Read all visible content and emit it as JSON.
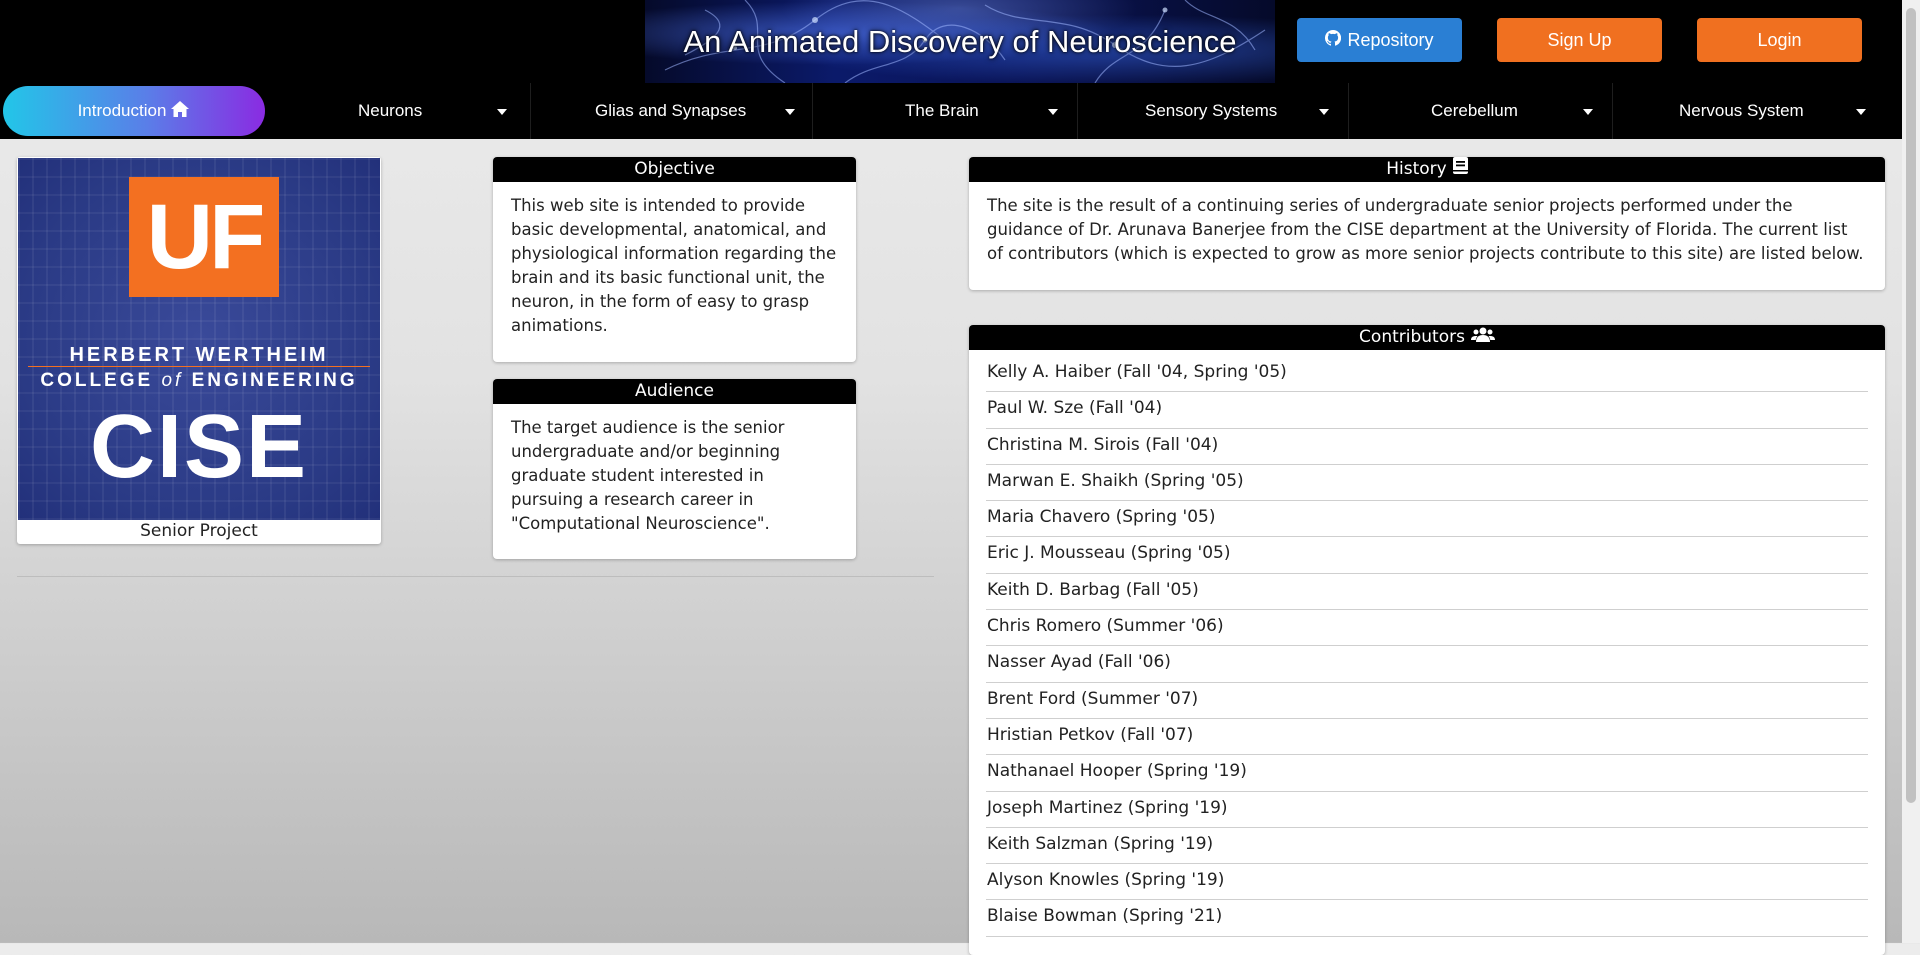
{
  "header": {
    "banner_title": "An Animated Discovery of Neuroscience",
    "repo_label": "Repository",
    "signup_label": "Sign Up",
    "login_label": "Login"
  },
  "nav": {
    "intro": "Introduction",
    "items": [
      "Neurons",
      "Glias and Synapses",
      "The Brain",
      "Sensory Systems",
      "Cerebellum",
      "Nervous System"
    ]
  },
  "logo": {
    "uf": "UF",
    "line1": "HERBERT WERTHEIM",
    "line2_a": "COLLEGE ",
    "line2_of": "of",
    "line2_b": " ENGINEERING",
    "cise": "CISE",
    "caption": "Senior Project"
  },
  "objective": {
    "title": "Objective",
    "text": "This web site is intended to provide basic developmental, anatomical, and physiological information regarding the brain and its basic functional unit, the neuron, in the form of easy to grasp animations."
  },
  "audience": {
    "title": "Audience",
    "text": "The target audience is the senior undergraduate and/or beginning graduate student interested in pursuing a research career in \"Computational Neuroscience\"."
  },
  "history": {
    "title": "History",
    "text": "The site is the result of a continuing series of undergraduate senior projects performed under the guidance of Dr. Arunava Banerjee from the CISE department at the University of Florida. The current list of contributors (which is expected to grow as more senior projects contribute to this site) are listed below."
  },
  "contributors": {
    "title": "Contributors",
    "list": [
      "Kelly A. Haiber (Fall '04, Spring '05)",
      "Paul W. Sze (Fall '04)",
      "Christina M. Sirois (Fall '04)",
      "Marwan E. Shaikh (Spring '05)",
      "Maria Chavero (Spring '05)",
      "Eric J. Mousseau (Spring '05)",
      "Keith D. Barbag (Fall '05)",
      "Chris Romero (Summer '06)",
      "Nasser Ayad (Fall '06)",
      "Brent Ford (Summer '07)",
      "Hristian Petkov (Fall '07)",
      "Nathanael Hooper (Spring '19)",
      "Joseph Martinez (Spring '19)",
      "Keith Salzman (Spring '19)",
      "Alyson Knowles (Spring '19)",
      "Blaise Bowman (Spring '21)",
      ""
    ]
  },
  "icons": {
    "repo": "github-icon",
    "intro": "home-icon",
    "history": "book-icon",
    "contributors": "users-icon",
    "nav_dropdown": "caret-down-icon"
  },
  "colors": {
    "accent_orange": "#f07020",
    "repo_blue": "#2a7fd4",
    "intro_gradient_start": "#22c6e8",
    "intro_gradient_end": "#8a2be2"
  }
}
